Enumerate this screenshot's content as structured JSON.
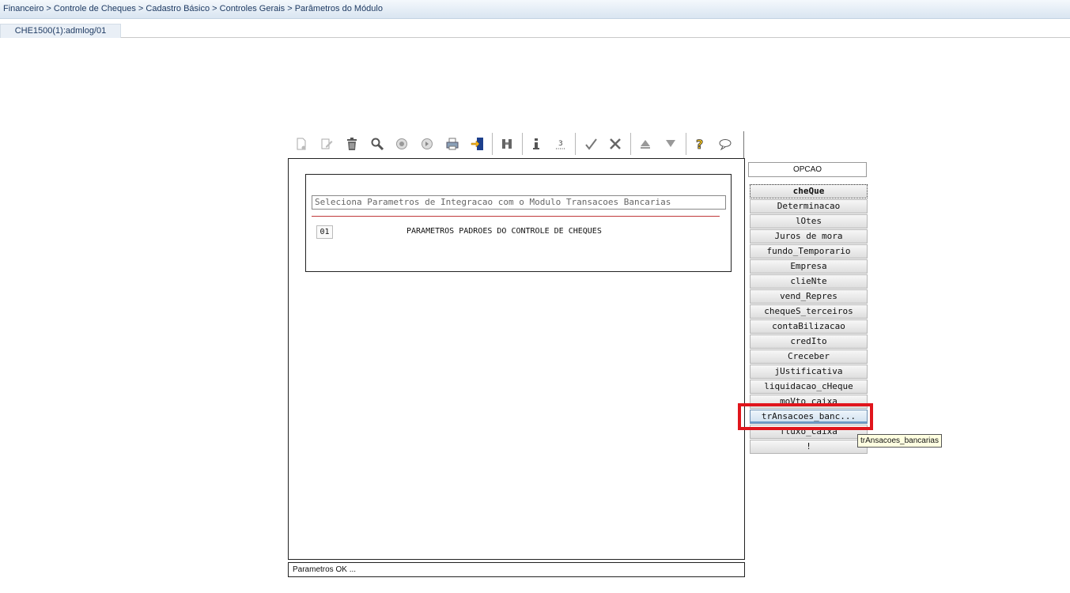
{
  "breadcrumb": "Financeiro > Controle de Cheques > Cadastro Básico > Controles Gerais > Parâmetros do Módulo",
  "tab": {
    "label": "CHE1500(1):admlog/01"
  },
  "toolbar": {
    "icons": [
      "new-document-icon",
      "edit-icon",
      "delete-trash-icon",
      "search-icon",
      "previous-circle-icon",
      "next-circle-icon",
      "print-icon",
      "exit-door-icon",
      "binoculars-icon",
      "info-icon",
      "count-icon",
      "confirm-check-icon",
      "cancel-tools-icon",
      "arrow-up-icon",
      "arrow-down-icon",
      "help-question-icon",
      "comment-bubble-icon"
    ]
  },
  "panel": {
    "select_text": "Seleciona Parametros de Integracao com o Modulo Transacoes Bancarias",
    "option_code": "01",
    "option_label": "PARAMETROS PADROES DO CONTROLE DE CHEQUES"
  },
  "status": {
    "message": "Parametros OK ..."
  },
  "side": {
    "title": "OPCAO",
    "buttons": [
      "cheQue",
      "Determinacao",
      "lOtes",
      "Juros de mora",
      "fundo_Temporario",
      "Empresa",
      "clieNte",
      "vend_Repres",
      "chequeS_terceiros",
      "contaBilizacao",
      "credIto",
      "Creceber",
      "jUstificativa",
      "liquidacao_cHeque",
      "moVto_caixa",
      "trAnsacoes_banc...",
      "fluxo_caixa",
      "!"
    ],
    "selected_index": 15
  },
  "tooltip": "trAnsacoes_bancarias",
  "colors": {
    "highlight": "#e0151c",
    "tooltip_bg": "#ffffe1",
    "separator": "#c0393b"
  }
}
